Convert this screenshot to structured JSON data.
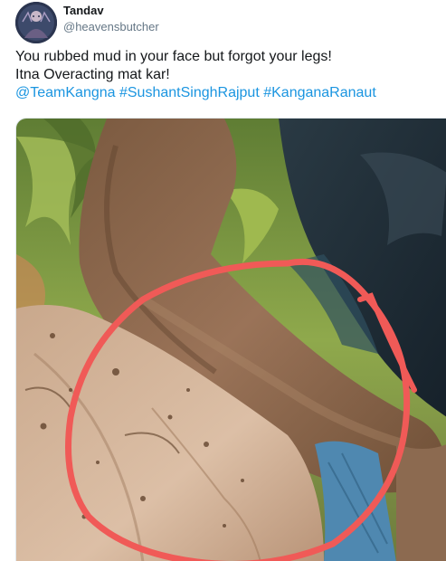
{
  "author": {
    "display_name": "Tandav",
    "handle": "@heavensbutcher",
    "avatar_icon": "avatar-image-icon"
  },
  "tweet": {
    "line1": "You rubbed mud in your face but forgot your legs!",
    "line2": "Itna Overacting mat kar!",
    "tags": [
      "@TeamKangna",
      "#SushantSinghRajput",
      "#KanganaRanaut"
    ]
  },
  "media": {
    "description_icon": "photo-icon",
    "annotation_color": "#f05a57"
  },
  "colors": {
    "link": "#1b95e0",
    "text": "#14171a",
    "muted": "#657786"
  }
}
